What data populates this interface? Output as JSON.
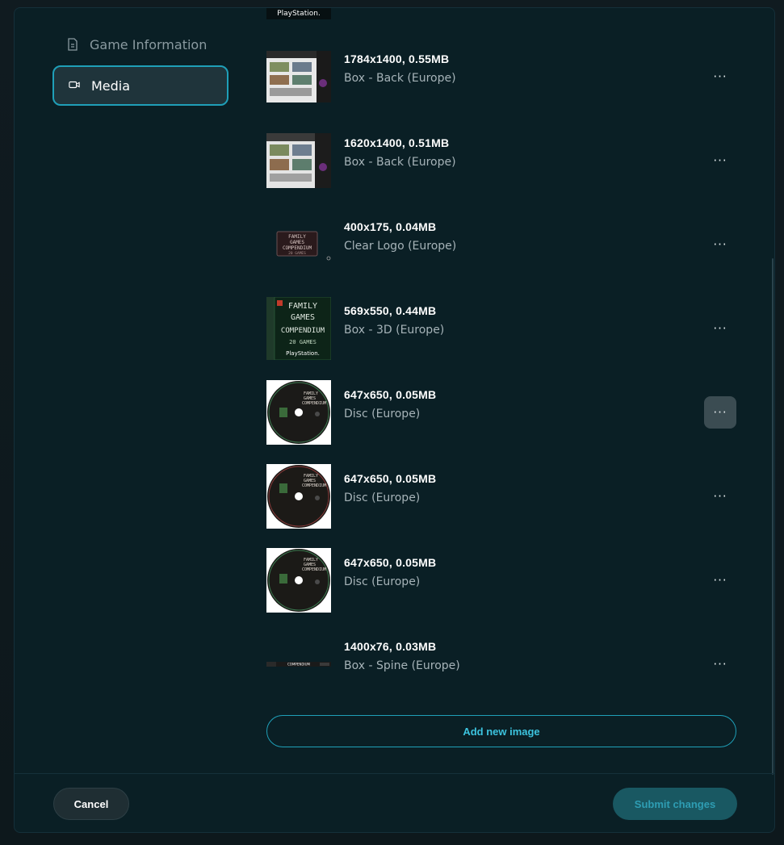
{
  "sidebar": {
    "items": [
      {
        "label": "Game Information",
        "icon": "document-icon",
        "active": false
      },
      {
        "label": "Media",
        "icon": "video-icon",
        "active": true
      }
    ]
  },
  "partial_thumb_text": "PlayStation.",
  "media": [
    {
      "dims": "1784x1400, 0.55MB",
      "type": "Box - Back (Europe)",
      "thumb": "box-back"
    },
    {
      "dims": "1620x1400, 0.51MB",
      "type": "Box - Back (Europe)",
      "thumb": "box-back"
    },
    {
      "dims": "400x175, 0.04MB",
      "type": "Clear Logo (Europe)",
      "thumb": "clear-logo",
      "thumb_lines": [
        "FAMILY",
        "GAMES",
        "COMPENDIUM",
        "20 GAMES"
      ]
    },
    {
      "dims": "569x550, 0.44MB",
      "type": "Box - 3D (Europe)",
      "thumb": "box-3d",
      "thumb_lines": [
        "FAMILY",
        "GAMES",
        "COMPENDIUM",
        "20 GAMES",
        "PlayStation."
      ]
    },
    {
      "dims": "647x650, 0.05MB",
      "type": "Disc (Europe)",
      "thumb": "disc",
      "hovered": true
    },
    {
      "dims": "647x650, 0.05MB",
      "type": "Disc (Europe)",
      "thumb": "disc"
    },
    {
      "dims": "647x650, 0.05MB",
      "type": "Disc (Europe)",
      "thumb": "disc"
    },
    {
      "dims": "1400x76, 0.03MB",
      "type": "Box - Spine (Europe)",
      "thumb": "box-spine",
      "thumb_lines": [
        "COMPENDIUM"
      ]
    }
  ],
  "more_label": "···",
  "add_button": "Add new image",
  "footer": {
    "cancel": "Cancel",
    "submit": "Submit changes"
  },
  "colors": {
    "accent": "#1f9fb8",
    "background": "#0a1f25"
  }
}
